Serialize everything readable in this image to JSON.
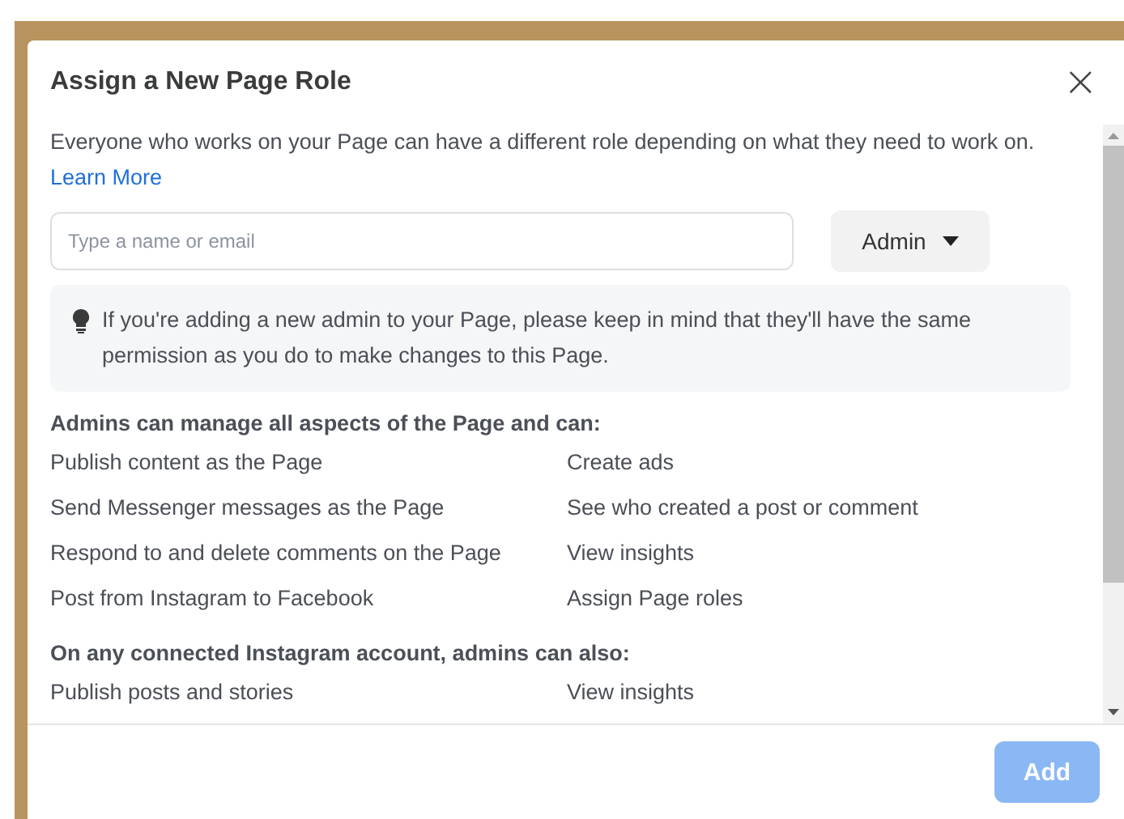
{
  "dialog": {
    "title": "Assign a New Page Role",
    "close": "×",
    "description": "Everyone who works on your Page can have a different role depending on what they need to work on.",
    "learn_more": "Learn More",
    "search": {
      "placeholder": "Type a name or email"
    },
    "role_button": {
      "label": "Admin"
    },
    "notice": "If you're adding a new admin to your Page, please keep in mind that they'll have the same permission as you do to make changes to this Page.",
    "sections": [
      {
        "heading": "Admins can manage all aspects of the Page and can:",
        "items": [
          [
            "Publish content as the Page",
            "Create ads"
          ],
          [
            "Send Messenger messages as the Page",
            "See who created a post or comment"
          ],
          [
            "Respond to and delete comments on the Page",
            "View insights"
          ],
          [
            "Post from Instagram to Facebook",
            "Assign Page roles"
          ]
        ]
      },
      {
        "heading": "On any connected Instagram account, admins can also:",
        "items": [
          [
            "Publish posts and stories",
            "View insights"
          ]
        ]
      }
    ],
    "add_button": {
      "label": "Add",
      "disabled": true
    }
  }
}
